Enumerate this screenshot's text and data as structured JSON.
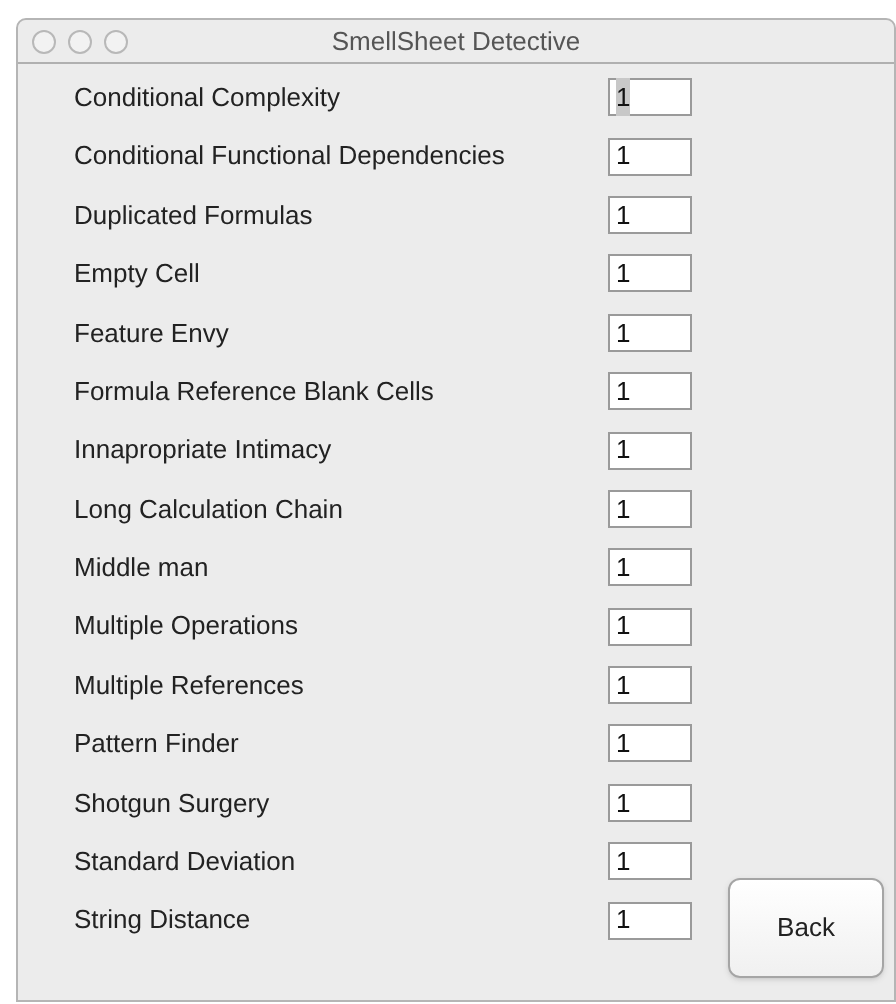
{
  "window": {
    "title": "SmellSheet Detective"
  },
  "rows": [
    {
      "label": "Conditional Complexity",
      "value": "1",
      "focused": true
    },
    {
      "label": "Conditional Functional Dependencies",
      "value": "1",
      "focused": false
    },
    {
      "label": "Duplicated Formulas",
      "value": "1",
      "focused": false
    },
    {
      "label": "Empty Cell",
      "value": "1",
      "focused": false
    },
    {
      "label": "Feature Envy",
      "value": "1",
      "focused": false
    },
    {
      "label": "Formula Reference Blank Cells",
      "value": "1",
      "focused": false
    },
    {
      "label": "Innapropriate Intimacy",
      "value": "1",
      "focused": false
    },
    {
      "label": "Long Calculation Chain",
      "value": "1",
      "focused": false
    },
    {
      "label": "Middle man",
      "value": "1",
      "focused": false
    },
    {
      "label": "Multiple Operations",
      "value": "1",
      "focused": false
    },
    {
      "label": "Multiple References",
      "value": "1",
      "focused": false
    },
    {
      "label": "Pattern Finder",
      "value": "1",
      "focused": false
    },
    {
      "label": "Shotgun Surgery",
      "value": "1",
      "focused": false
    },
    {
      "label": "Standard Deviation",
      "value": "1",
      "focused": false
    },
    {
      "label": "String Distance",
      "value": "1",
      "focused": false
    }
  ],
  "back_button": "Back"
}
